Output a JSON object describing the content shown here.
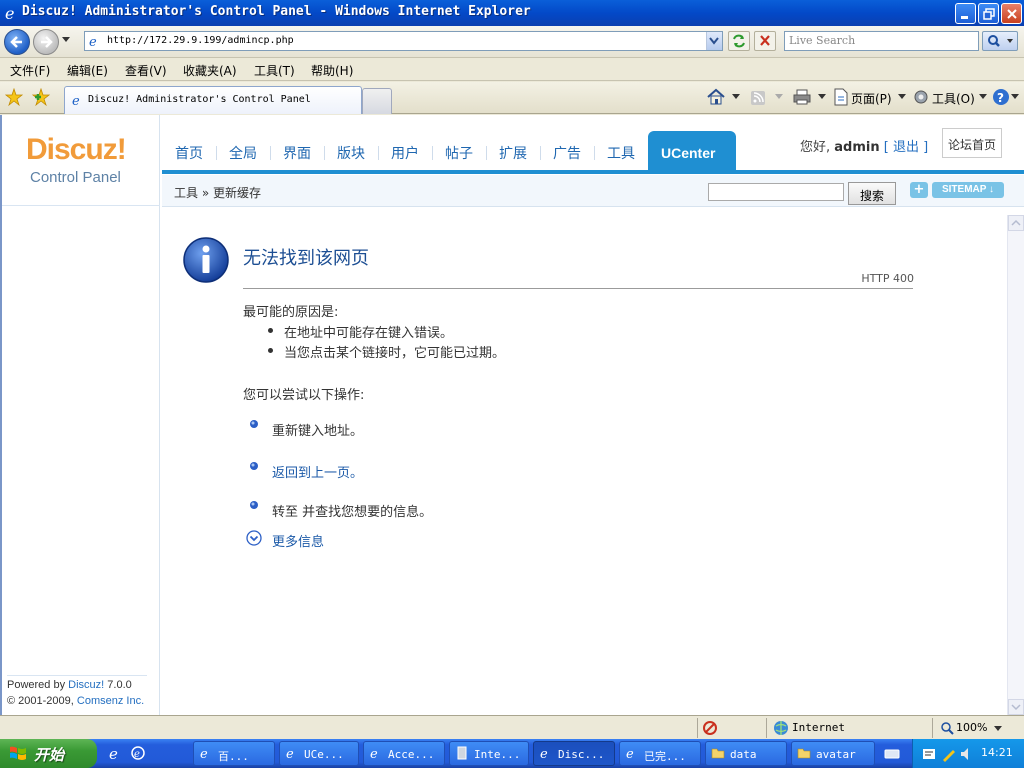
{
  "window": {
    "title": "Discuz! Administrator's Control Panel - Windows Internet Explorer"
  },
  "browser": {
    "url": "http://172.29.9.199/admincp.php",
    "search_placeholder": "Live Search",
    "menu": [
      "文件(F)",
      "编辑(E)",
      "查看(V)",
      "收藏夹(A)",
      "工具(T)",
      "帮助(H)"
    ],
    "tab_title": "Discuz! Administrator's Control Panel",
    "commands": {
      "page": "页面(P)",
      "tools": "工具(O)"
    },
    "status": {
      "zone": "Internet",
      "zoom": "100%"
    }
  },
  "site": {
    "logo": "Discuz!",
    "logo_sub": "Control Panel",
    "nav": [
      "首页",
      "全局",
      "界面",
      "版块",
      "用户",
      "帖子",
      "扩展",
      "广告",
      "工具"
    ],
    "nav_active": "UCenter",
    "greeting_prefix": "您好,",
    "username": "admin",
    "logout": "[ 退出 ]",
    "forum_home": "论坛首页",
    "breadcrumb": "工具 » 更新缓存",
    "search_button": "搜索",
    "plus_label": "+",
    "sitemap_label": "SITEMAP",
    "powered_prefix": "Powered by ",
    "powered_brand": "Discuz!",
    "powered_version": " 7.0.0",
    "copyright_prefix": "© 2001-2009, ",
    "copyright_company": "Comsenz Inc."
  },
  "error_page": {
    "title": "无法找到该网页",
    "code": "HTTP 400",
    "reason_heading": "最可能的原因是:",
    "reasons": [
      "在地址中可能存在键入错误。",
      "当您点击某个链接时，它可能已过期。"
    ],
    "try_heading": "您可以尝试以下操作:",
    "actions": [
      "重新键入地址。",
      "返回到上一页。",
      "转至  并查找您想要的信息。"
    ],
    "more_info": "更多信息"
  },
  "taskbar": {
    "start": "开始",
    "tasks": [
      "百...",
      "UCe...",
      "Acce...",
      "Inte...",
      "Disc...",
      "已完...",
      "data",
      "avatar"
    ],
    "clock": "14:21"
  }
}
